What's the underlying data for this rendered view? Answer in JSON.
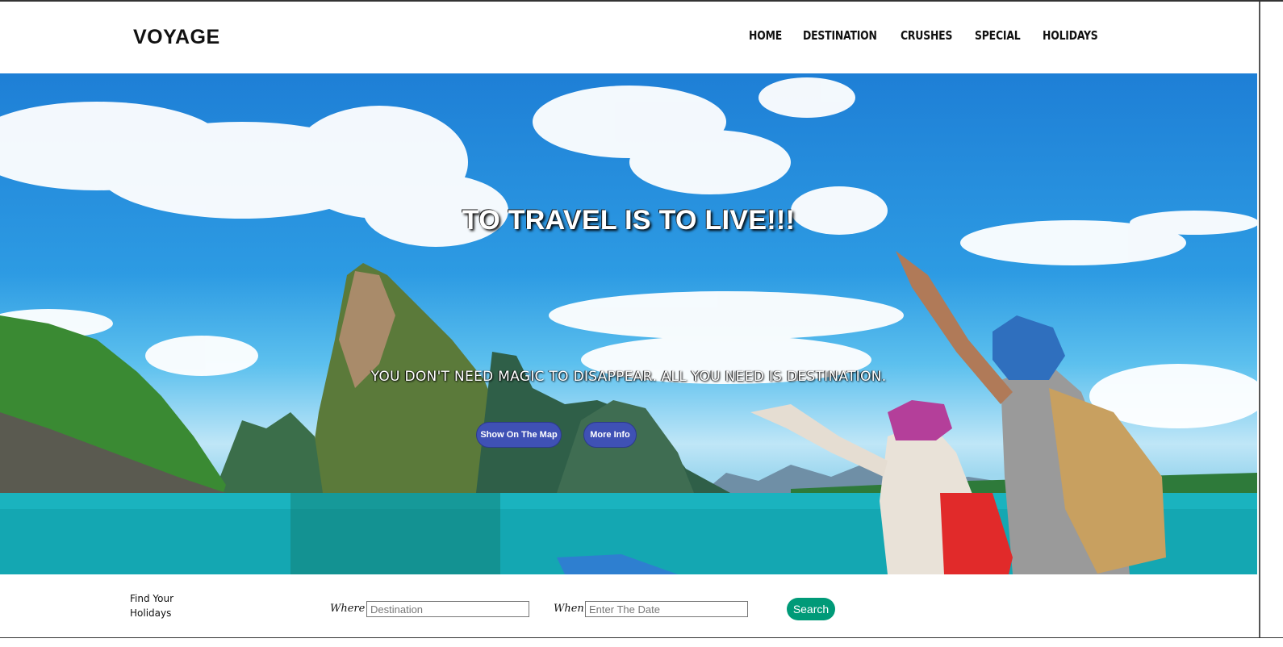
{
  "brand": "VOYAGE",
  "nav": [
    {
      "label": "HOME"
    },
    {
      "label": "DESTINATION"
    },
    {
      "label": "CRUSHES"
    },
    {
      "label": "SPECIAL"
    },
    {
      "label": "HOLIDAYS"
    }
  ],
  "hero": {
    "title": "TO TRAVEL IS TO LIVE!!!",
    "subtitle": "YOU DON'T NEED MAGIC TO DISAPPEAR. ALL YOU NEED IS DESTINATION.",
    "buttons": {
      "map": "Show On The Map",
      "info": "More Info"
    },
    "colors": {
      "button": "#3f51b5"
    }
  },
  "search": {
    "caption_line1": "Find Your",
    "caption_line2": "Holidays",
    "where_label": "Where",
    "where_placeholder": "Destination",
    "when_label": "When",
    "when_placeholder": "Enter The Date",
    "button": "Search",
    "colors": {
      "button": "#009a78"
    }
  }
}
